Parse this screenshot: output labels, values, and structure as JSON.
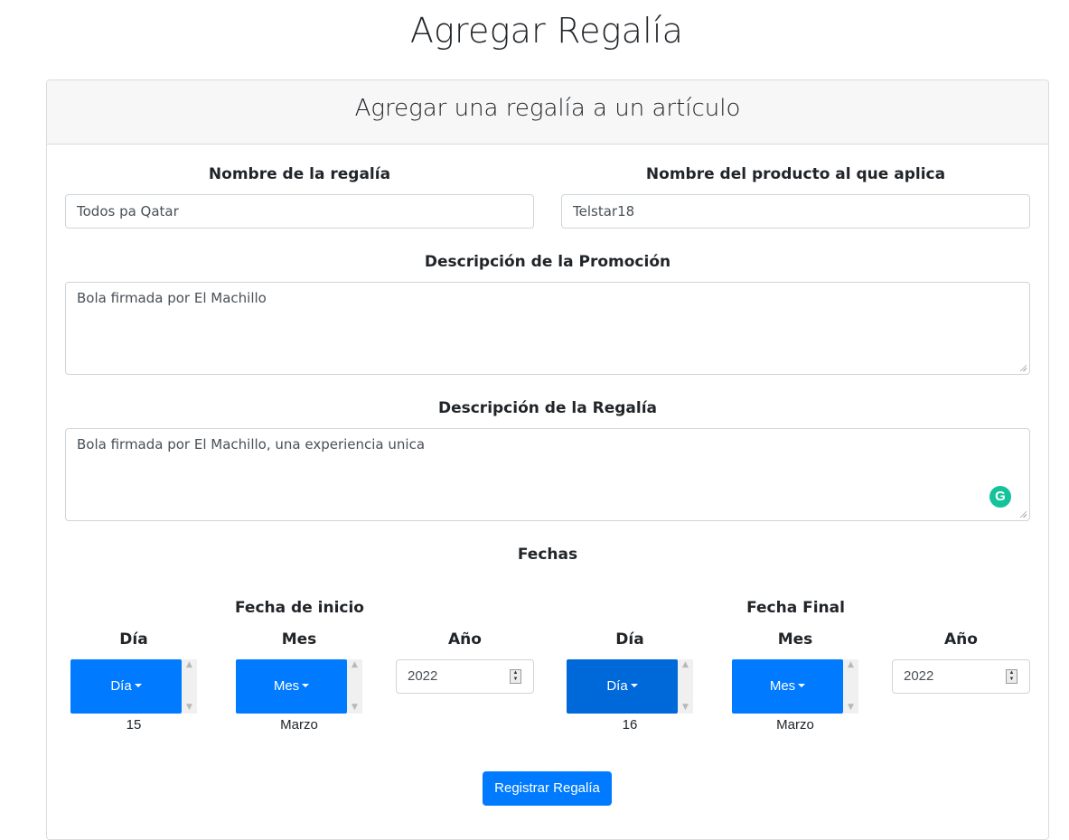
{
  "page": {
    "title": "Agregar Regalía"
  },
  "card": {
    "header": "Agregar una regalía a un artículo"
  },
  "form": {
    "royalty_name": {
      "label": "Nombre de la regalía",
      "value": "Todos pa Qatar"
    },
    "product_name": {
      "label": "Nombre del producto al que aplica",
      "value": "Telstar18"
    },
    "promo_desc": {
      "label": "Descripción de la Promoción",
      "value": "Bola firmada por El Machillo"
    },
    "royalty_desc": {
      "label": "Descripción de la Regalía",
      "value": "Bola firmada por El Machillo, una experiencia unica"
    },
    "dates_title": "Fechas",
    "start": {
      "title": "Fecha de inicio",
      "day_label": "Día",
      "day_button": "Día",
      "day_value": "15",
      "month_label": "Mes",
      "month_button": "Mes",
      "month_value": "Marzo",
      "year_label": "Año",
      "year_value": "2022"
    },
    "end": {
      "title": "Fecha Final",
      "day_label": "Día",
      "day_button": "Día",
      "day_value": "16",
      "month_label": "Mes",
      "month_button": "Mes",
      "month_value": "Marzo",
      "year_label": "Año",
      "year_value": "2022"
    },
    "submit_label": "Registrar Regalía"
  },
  "icons": {
    "grammarly": "grammarly-icon",
    "grammarly_color": "#15c39a"
  },
  "colors": {
    "primary": "#007bff",
    "primary_active": "#0069d9"
  }
}
